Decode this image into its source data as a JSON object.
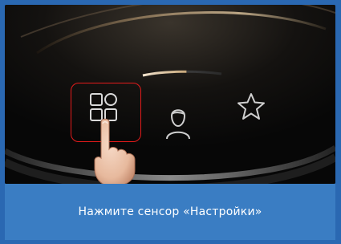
{
  "instruction": "Нажмите сенсор «Настройки»",
  "icons": {
    "menu": "apps-grid-icon",
    "profile": "user-icon",
    "favorite": "star-icon"
  },
  "colors": {
    "frame": "#2a68b2",
    "caption_bg": "#3a7dc3",
    "screen_bg": "#0b0b0b",
    "highlight": "#e41b1b",
    "text": "#ffffff"
  }
}
